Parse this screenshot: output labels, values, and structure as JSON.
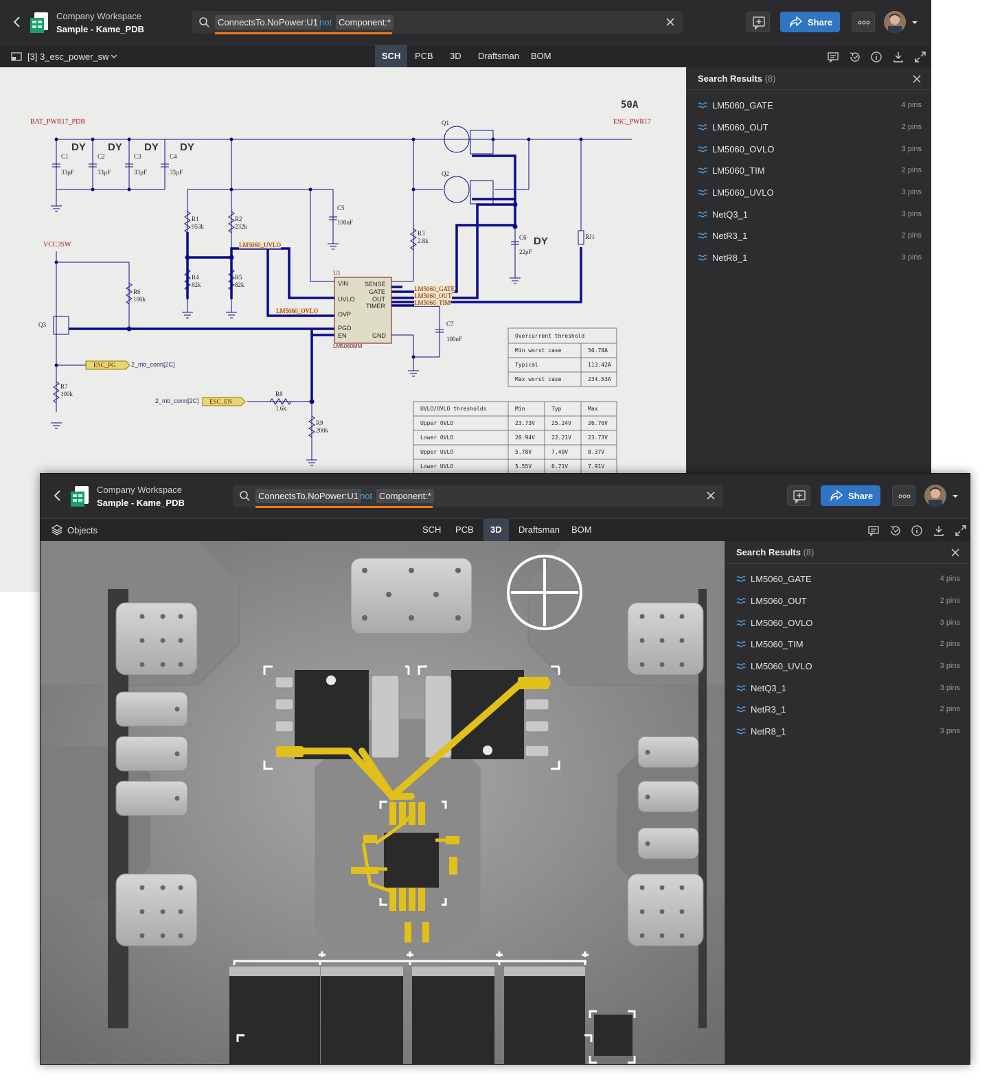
{
  "header": {
    "workspace": "Company Workspace",
    "project": "Sample - Kame_PDB",
    "share_label": "Share"
  },
  "search": {
    "chip1": "ConnectsTo.NoPower:U1",
    "keyword": "not",
    "chip2": "Component:*"
  },
  "window1": {
    "sheet_selector": "[3] 3_esc_power_sw",
    "active_tab": "SCH"
  },
  "window2": {
    "objects_label": "Objects",
    "active_tab": "3D"
  },
  "tabs": [
    "SCH",
    "PCB",
    "3D",
    "Draftsman",
    "BOM"
  ],
  "panel": {
    "title": "Search Results",
    "count": "(8)",
    "results": [
      {
        "name": "LM5060_GATE",
        "pins": "4 pins"
      },
      {
        "name": "LM5060_OUT",
        "pins": "2 pins"
      },
      {
        "name": "LM5060_OVLO",
        "pins": "3 pins"
      },
      {
        "name": "LM5060_TIM",
        "pins": "2 pins"
      },
      {
        "name": "LM5060_UVLO",
        "pins": "3 pins"
      },
      {
        "name": "NetQ3_1",
        "pins": "3 pins"
      },
      {
        "name": "NetR3_1",
        "pins": "2 pins"
      },
      {
        "name": "NetR8_1",
        "pins": "3 pins"
      }
    ]
  },
  "schematic": {
    "rating": "50A",
    "nets": {
      "bat": "BAT_PWR17_PDB",
      "esc_pwr": "ESC_PWR17",
      "vcc": "VCC3SW",
      "uvlo": "LM5060_UVLO",
      "ovlo": "LM5060_OVLO",
      "gate": "LM5060_GATE",
      "out": "LM5060_OUT",
      "tim": "LM5060_TIM"
    },
    "dy": "DY",
    "caps": [
      {
        "ref": "C1",
        "val": "33µF"
      },
      {
        "ref": "C2",
        "val": "33µF"
      },
      {
        "ref": "C3",
        "val": "33µF"
      },
      {
        "ref": "C4",
        "val": "33µF"
      }
    ],
    "c5": {
      "ref": "C5",
      "val": "100nF"
    },
    "c6": {
      "ref": "C6",
      "val": "22pF"
    },
    "c7": {
      "ref": "C7",
      "val": "100nF"
    },
    "resistors": {
      "r1": {
        "ref": "R1",
        "val": "953k"
      },
      "r2": {
        "ref": "R2",
        "val": "232k"
      },
      "r3": {
        "ref": "R3",
        "val": "2.8k"
      },
      "r4": {
        "ref": "R4",
        "val": "82k"
      },
      "r5": {
        "ref": "R5",
        "val": "82k"
      },
      "r6": {
        "ref": "R6",
        "val": "100k"
      },
      "r7": {
        "ref": "R7",
        "val": "100k"
      },
      "r8": {
        "ref": "R8",
        "val": "1.6k"
      },
      "r9": {
        "ref": "R9",
        "val": "200k"
      },
      "rj1": {
        "ref": "RJ1"
      }
    },
    "q1": "Q1",
    "q2": "Q2",
    "q3": "Q3",
    "u1": {
      "ref": "U1",
      "part": "LM5060MM",
      "pins_left": [
        "VIN",
        "UVLO",
        "OVP",
        "PGD",
        "EN"
      ],
      "pins_right": [
        "SENSE",
        "GATE",
        "OUT",
        "TIMER",
        "GND"
      ]
    },
    "esc_pg": "ESC_PG",
    "esc_en": "ESC_EN",
    "mb_conn": "2_mb_conn[2C]",
    "overcurrent": {
      "title": "Overcurrent threshold",
      "rows": [
        [
          "Min worst case",
          "50.78A"
        ],
        [
          "Typical",
          "113.42A"
        ],
        [
          "Max worst case",
          "234.53A"
        ]
      ]
    },
    "thresholds": {
      "headers": [
        "UVLO/OVLO thresholds",
        "Min",
        "Typ",
        "Max"
      ],
      "rows": [
        [
          "Upper OVLO",
          "23.73V",
          "25.24V",
          "26.76V"
        ],
        [
          "Lower OVLO",
          "20.94V",
          "22.21V",
          "23.73V"
        ],
        [
          "Upper UVLO",
          "5.78V",
          "7.40V",
          "8.37V"
        ],
        [
          "Lower UVLO",
          "5.55V",
          "6.71V",
          "7.91V"
        ]
      ]
    }
  },
  "colors": {
    "wire": "#0b0b8a",
    "highlight": "#e7c01a",
    "accent": "#2f75c4",
    "search_underline": "#f07a1a"
  }
}
